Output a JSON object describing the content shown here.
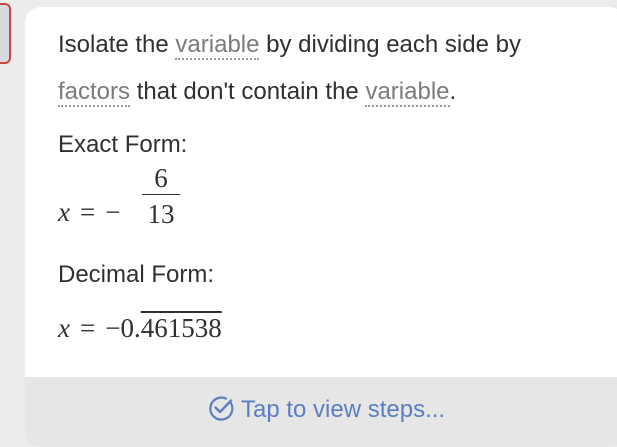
{
  "instruction": {
    "part1": "Isolate the ",
    "term1": "variable",
    "part2": " by dividing each side by ",
    "term2": "factors",
    "part3": " that don't contain the ",
    "term3": "variable",
    "part4": "."
  },
  "exact_form": {
    "label": "Exact Form:",
    "variable": "x",
    "equals": "=",
    "sign": "−",
    "numerator": "6",
    "denominator": "13"
  },
  "decimal_form": {
    "label": "Decimal Form:",
    "variable": "x",
    "equals": "=",
    "prefix": "−0.",
    "repeating": "461538"
  },
  "footer": {
    "link_label": "Tap to view steps...",
    "icon": "check-circle-icon",
    "link_color": "#5b7fc1"
  }
}
